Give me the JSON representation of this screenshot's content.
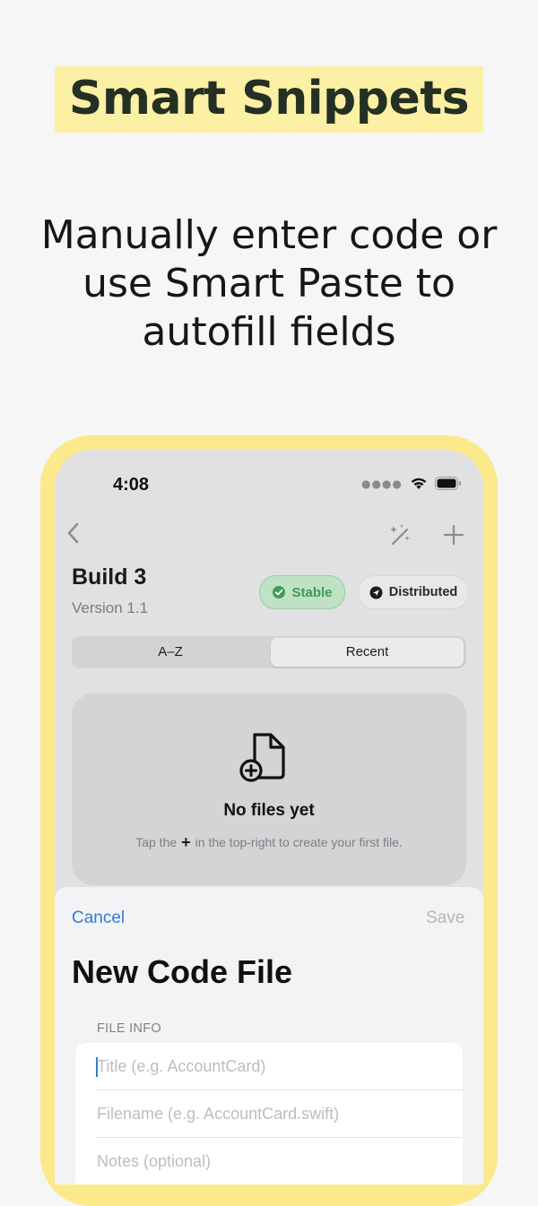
{
  "headline": "Smart Snippets",
  "subhead": "Manually enter code or use Smart Paste to autofill fields",
  "status_bar": {
    "time": "4:08"
  },
  "build": {
    "title": "Build 3",
    "version": "Version 1.1"
  },
  "badges": {
    "stable": "Stable",
    "distributed": "Distributed"
  },
  "segments": {
    "az": "A–Z",
    "recent": "Recent",
    "selected": "Recent"
  },
  "empty_state": {
    "title": "No files yet",
    "hint_before": "Tap the",
    "hint_after": "in the top-right to create your first file."
  },
  "sheet": {
    "cancel": "Cancel",
    "save": "Save",
    "title": "New Code File",
    "section_label": "FILE INFO",
    "fields": {
      "title_placeholder": "Title (e.g. AccountCard)",
      "filename_placeholder": "Filename (e.g. AccountCard.swift)",
      "notes_placeholder": "Notes (optional)"
    }
  },
  "colors": {
    "headline_highlight": "#fbf0a3",
    "phone_frame": "#fbe98c",
    "stable_green": "#3f9b55",
    "link_blue": "#2f7fd6"
  },
  "icons": [
    "chevron-left-icon",
    "magic-wand-icon",
    "plus-icon",
    "wifi-icon",
    "battery-icon",
    "checkmark-seal-icon",
    "paperplane-icon",
    "doc-badge-plus-icon"
  ]
}
